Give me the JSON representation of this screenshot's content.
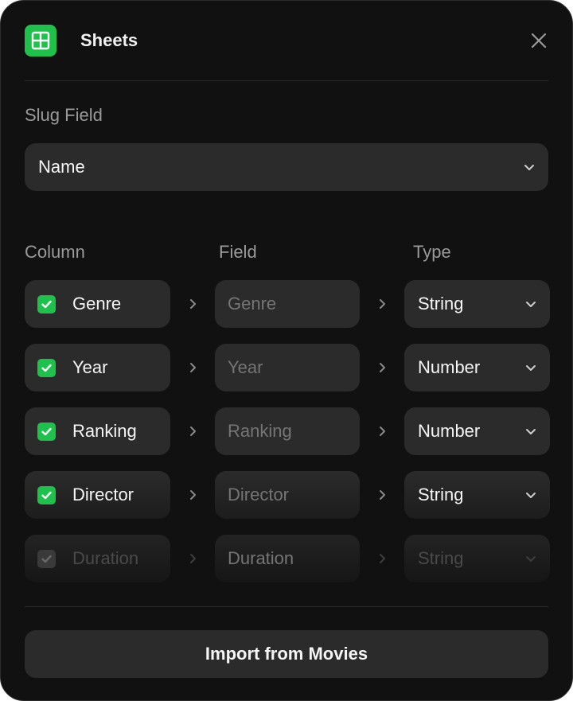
{
  "header": {
    "app_icon": "sheets-grid-icon",
    "title": "Sheets",
    "close_icon": "close-icon"
  },
  "slug": {
    "label": "Slug Field",
    "selected": "Name"
  },
  "table": {
    "headers": {
      "column": "Column",
      "field": "Field",
      "type": "Type"
    },
    "rows": [
      {
        "column": "Genre",
        "checked": true,
        "field_placeholder": "Genre",
        "type": "String",
        "enabled": true
      },
      {
        "column": "Year",
        "checked": true,
        "field_placeholder": "Year",
        "type": "Number",
        "enabled": true
      },
      {
        "column": "Ranking",
        "checked": true,
        "field_placeholder": "Ranking",
        "type": "Number",
        "enabled": true
      },
      {
        "column": "Director",
        "checked": true,
        "field_placeholder": "Director",
        "type": "String",
        "enabled": true
      },
      {
        "column": "Duration",
        "checked": true,
        "field_placeholder": "Duration",
        "type": "String",
        "enabled": false
      }
    ]
  },
  "footer": {
    "import_label": "Import from Movies"
  },
  "colors": {
    "accent": "#1ec24a",
    "background": "#111111",
    "surface": "#2b2b2b",
    "muted_text": "#9a9a9a"
  }
}
